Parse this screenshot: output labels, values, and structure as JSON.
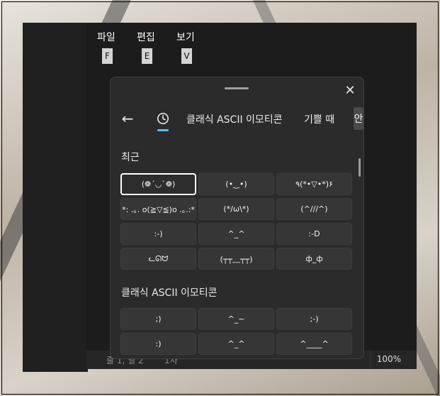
{
  "menu": {
    "file": "파일",
    "edit": "편집",
    "view": "보기"
  },
  "keytips": {
    "file": "F",
    "edit": "E",
    "view": "V"
  },
  "status": {
    "position": "줄 1, 열 2",
    "chars": "1자",
    "zoom": "100%"
  },
  "panel": {
    "close_icon": "close-icon",
    "tabs": [
      {
        "label": "클래식 ASCII 이모티콘"
      },
      {
        "label": "기쁠 때"
      },
      {
        "label": "안"
      }
    ],
    "recent_title": "최근",
    "recent": [
      "(❁´◡`❁)",
      "(•‿•)",
      "٩(*•▽•*)۶",
      "*: .｡. o(≧▽≦)o .｡.:*",
      "(*/ω\\*)",
      "(^///^)",
      ":-)",
      "^_^",
      ":-D",
      "ᓚᘏᗢ",
      "(┬┬﹏┬┬)",
      "ф_ф"
    ],
    "classic_title": "클래식 ASCII 이모티콘",
    "classic": [
      ";)",
      "^_~",
      ";-)",
      ":)",
      "^_^",
      "^____^"
    ]
  },
  "colors": {
    "accent": "#4cc2ff",
    "panel_bg": "#2b2b2b",
    "cell_bg": "#363636"
  }
}
